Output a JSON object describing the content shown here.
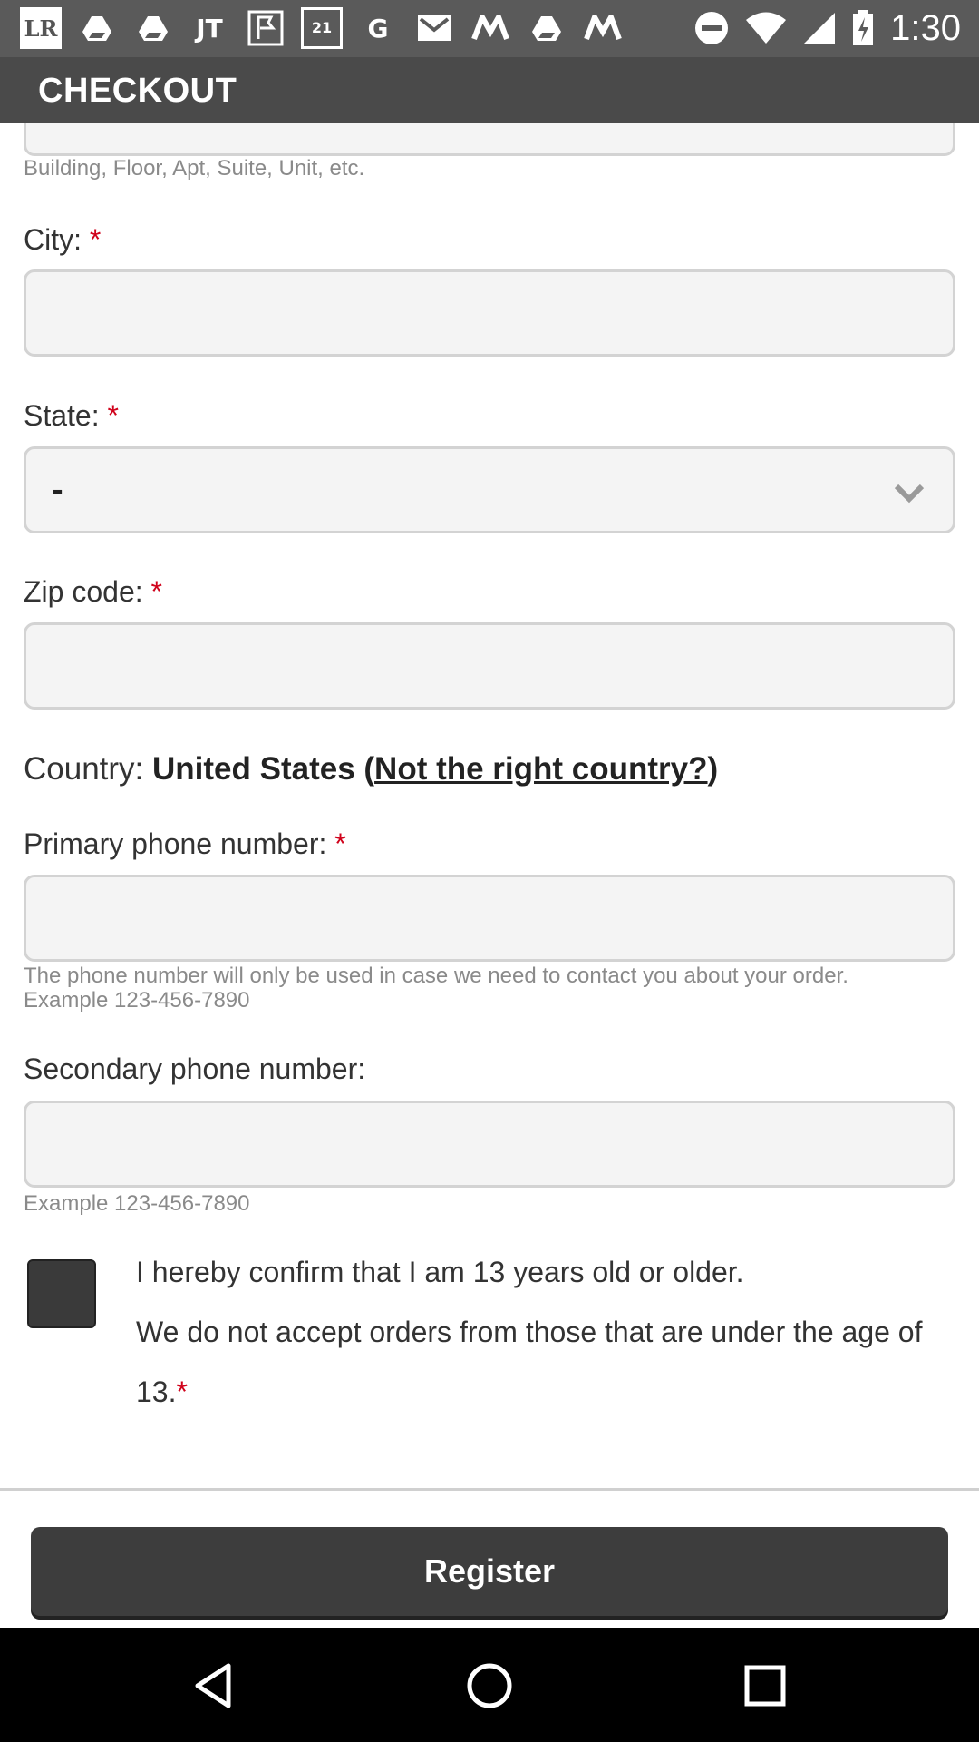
{
  "status_bar": {
    "time": "1:30",
    "notification_icons": [
      "LR",
      "JT",
      "21",
      "G"
    ],
    "icons": [
      "lr-icon",
      "drive-icon",
      "drive-icon",
      "jt-icon",
      "flag-icon",
      "forever21-icon",
      "google-icon",
      "gmail-icon",
      "moto-icon",
      "drive-icon",
      "moto-icon",
      "dnd-icon",
      "wifi-icon",
      "signal-icon",
      "battery-icon"
    ]
  },
  "app_bar": {
    "title": "CHECKOUT"
  },
  "form": {
    "address2_help": "Building, Floor, Apt, Suite, Unit, etc.",
    "city_label": "City:",
    "state_label": "State:",
    "state_value": "-",
    "zip_label": "Zip code:",
    "country_prefix": "Country: ",
    "country_value": "United States",
    "country_open_paren": " (",
    "country_link": "Not the right country?",
    "country_close_paren": ")",
    "primary_phone_label": "Primary phone number:",
    "primary_phone_help_1": "The phone number will only be used in case we need to contact you about your order.",
    "primary_phone_help_2": "Example 123-456-7890",
    "secondary_phone_label": "Secondary phone number:",
    "secondary_phone_help": "Example 123-456-7890",
    "confirm_line1": "I hereby confirm that I am 13 years old or older.",
    "confirm_line2": "We do not accept orders from those that are under the age of 13.",
    "required_mark": "*",
    "register_label": "Register"
  },
  "colors": {
    "required": "#d0021b",
    "button": "#3d3d3d",
    "app_bar": "#4a4a4a"
  }
}
